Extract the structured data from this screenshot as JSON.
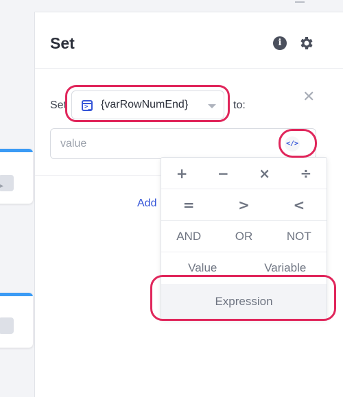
{
  "panel": {
    "title": "Set",
    "info_icon_glyph": "i",
    "set_label": "Set",
    "to_label": "to:",
    "variable": {
      "icon": "variable-icon",
      "icon_glyph": ">_",
      "value": "{varRowNumEnd}"
    },
    "value_input": {
      "value": "",
      "placeholder": "value"
    },
    "code_button_glyph": "</>",
    "close_glyph": "✕",
    "add_link_label": "Add"
  },
  "operator_menu": {
    "arithmetic": [
      "+",
      "−",
      "×",
      "÷"
    ],
    "comparison": [
      "=",
      ">",
      "<"
    ],
    "logical": [
      "AND",
      "OR",
      "NOT"
    ],
    "kinds": [
      "Value",
      "Variable"
    ],
    "expression_label": "Expression"
  },
  "colors": {
    "accent": "#3656d8",
    "highlight": "#e0265b",
    "node_bar": "#3b9bf5"
  }
}
